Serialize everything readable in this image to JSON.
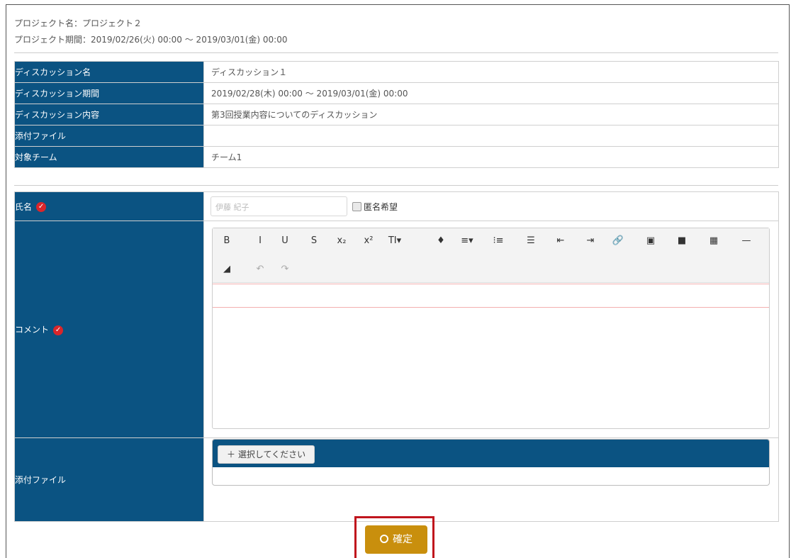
{
  "project": {
    "name_line": "プロジェクト名：プロジェクト２",
    "period_line": "プロジェクト期間：2019/02/26(火) 00:00 〜 2019/03/01(金) 00:00"
  },
  "info": [
    {
      "label": "ディスカッション名",
      "value": "ディスカッション１"
    },
    {
      "label": "ディスカッション期間",
      "value": "2019/02/28(木) 00:00 〜 2019/03/01(金) 00:00"
    },
    {
      "label": "ディスカッション内容",
      "value": "第3回授業内容についてのディスカッション"
    },
    {
      "label": "添付ファイル",
      "value": ""
    },
    {
      "label": "対象チーム",
      "value": "チーム1"
    }
  ],
  "form": {
    "name_label": "氏名",
    "name_value": "伊藤 紀子",
    "anonymous_label": "匿名希望",
    "comment_label": "コメント",
    "attachment_label": "添付ファイル",
    "select_button": "選択してください",
    "confirm_button": "確定"
  },
  "toolbar_row1": [
    "B",
    "I",
    "U",
    "S",
    "x₂",
    "x²",
    "TI▾",
    "♦",
    "≡▾",
    "⁝≡",
    "☰",
    "⇤",
    "⇥",
    "🔗",
    "▣",
    "■",
    "▦",
    "—"
  ],
  "toolbar_row2": [
    "◢",
    "↶",
    "↷"
  ],
  "colors": {
    "header_blue": "#0b5382",
    "confirm": "#c98f0d",
    "highlight": "#c0151d",
    "required_check": "#d9262b"
  }
}
